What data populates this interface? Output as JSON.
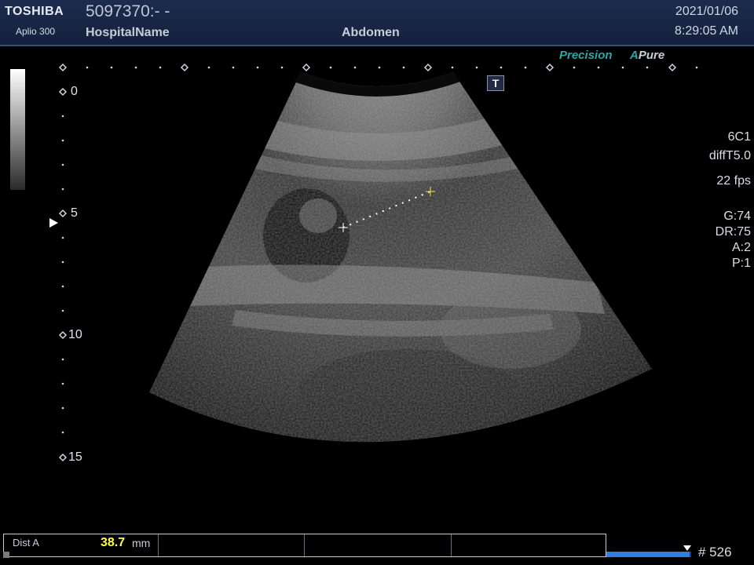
{
  "header": {
    "brand": "TOSHIBA",
    "model": "Aplio 300",
    "patient_id": "5097370:- -",
    "hospital": "HospitalName",
    "exam": "Abdomen",
    "date": "2021/01/06",
    "time": "8:29:05 AM"
  },
  "logos": {
    "precision": "Precision",
    "apure_a": "A",
    "apure_text": "Pure"
  },
  "t_button": "T",
  "depth_scale": {
    "labels": [
      "0",
      "5",
      "10",
      "15"
    ],
    "unit_note": ""
  },
  "params": {
    "probe": "6C1",
    "preset": "diffT5.0",
    "fps": "22 fps",
    "gain": "G:74",
    "dynamic_range": "DR:75",
    "a": "A:2",
    "p": "P:1"
  },
  "measurement": {
    "label": "Dist A",
    "value": "38.7",
    "unit": "mm"
  },
  "cine": {
    "position_fraction": 0.98,
    "frame_label": "# 526"
  },
  "colors": {
    "header_bg": "#1d2c4e",
    "accent_teal": "#2ea6a6",
    "measurement_yellow": "#ffff40",
    "caliper_color": "#ffdd33"
  }
}
